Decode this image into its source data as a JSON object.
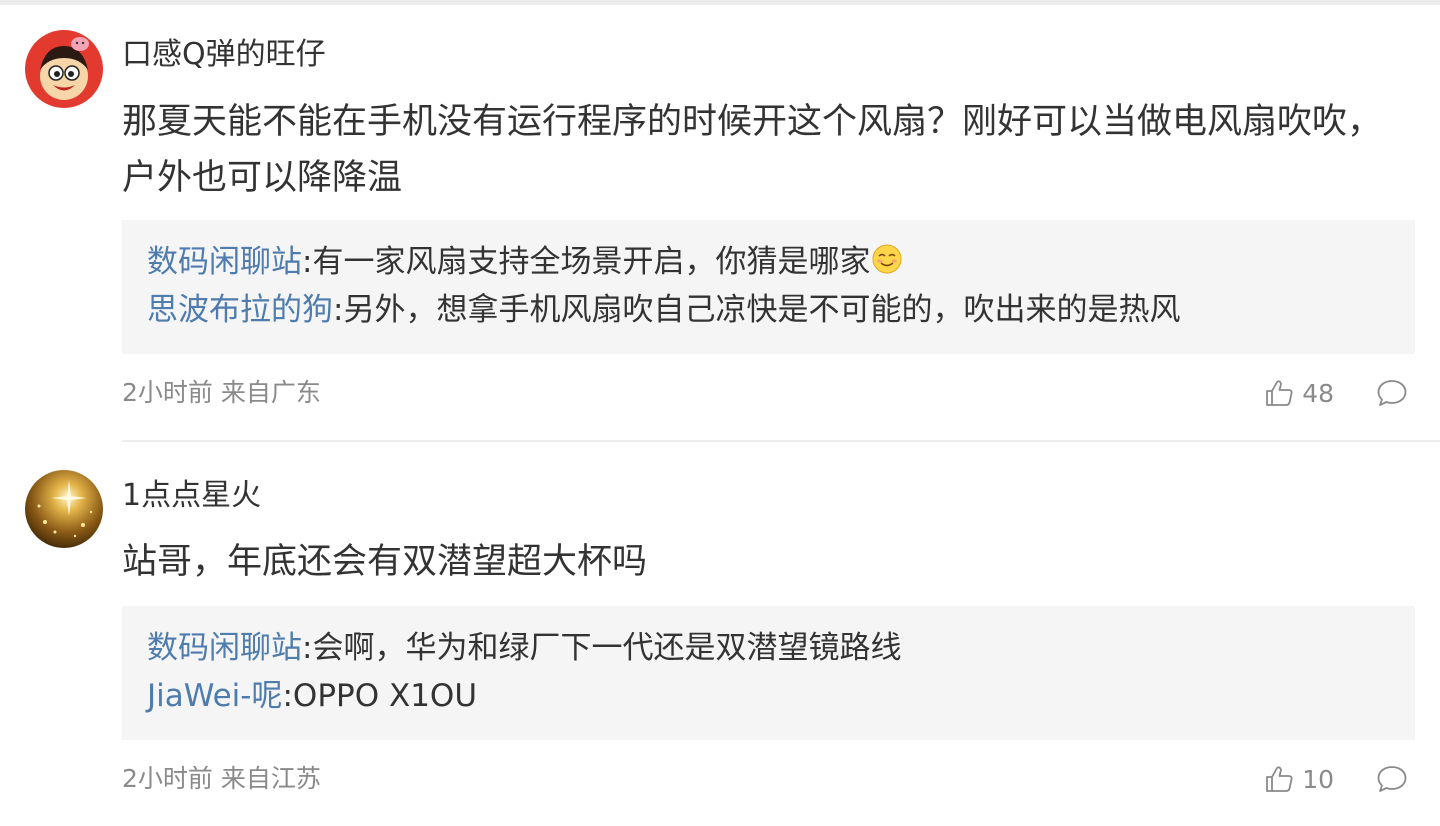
{
  "comments": [
    {
      "username": "口感Q弹的旺仔",
      "avatar_icon": "wangzai-mascot-avatar",
      "text": "那夏天能不能在手机没有运行程序的时候开这个风扇？刚好可以当做电风扇吹吹，户外也可以降降温",
      "replies": [
        {
          "author": "数码闲聊站",
          "sep": ":",
          "text": "有一家风扇支持全场景开启，你猜是哪家",
          "emoji": "smirk-emoji"
        },
        {
          "author": "思波布拉的狗",
          "sep": ":",
          "text": "另外，想拿手机风扇吹自己凉快是不可能的，吹出来的是热风"
        }
      ],
      "time": "2小时前",
      "location": "来自广东",
      "likes": "48"
    },
    {
      "username": "1点点星火",
      "avatar_icon": "golden-sparkle-avatar",
      "text": "站哥，年底还会有双潜望超大杯吗",
      "replies": [
        {
          "author": "数码闲聊站",
          "sep": ":",
          "text": "会啊，华为和绿厂下一代还是双潜望镜路线"
        },
        {
          "author": "JiaWei-呢",
          "sep": ":",
          "text": "OPPO X1OU"
        }
      ],
      "time": "2小时前",
      "location": "来自江苏",
      "likes": "10"
    }
  ],
  "colors": {
    "author_link": "#4f7cae",
    "meta_text": "#8a8a8a",
    "reply_bg": "#f5f5f5",
    "divider": "#ececec"
  }
}
